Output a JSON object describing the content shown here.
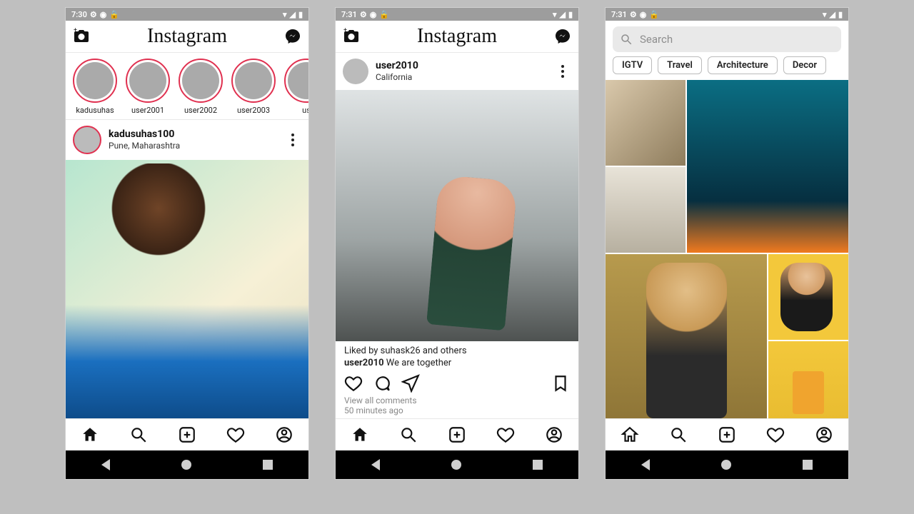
{
  "app_name": "Instagram",
  "phone1": {
    "time": "7:30",
    "stories": [
      {
        "user": "kadusuhas"
      },
      {
        "user": "user2001"
      },
      {
        "user": "user2002"
      },
      {
        "user": "user2003"
      },
      {
        "user": "us"
      }
    ],
    "post": {
      "user": "kadusuhas100",
      "location": "Pune, Maharashtra"
    }
  },
  "phone2": {
    "time": "7:31",
    "post": {
      "user": "user2010",
      "location": "California",
      "liked_by": "Liked by suhask26 and others",
      "caption_user": "user2010",
      "caption_text": " We are together",
      "view_comments": "View all comments",
      "timestamp": "50 minutes ago"
    }
  },
  "phone3": {
    "time": "7:31",
    "search_placeholder": "Search",
    "chips": [
      "IGTV",
      "Travel",
      "Architecture",
      "Decor"
    ]
  }
}
